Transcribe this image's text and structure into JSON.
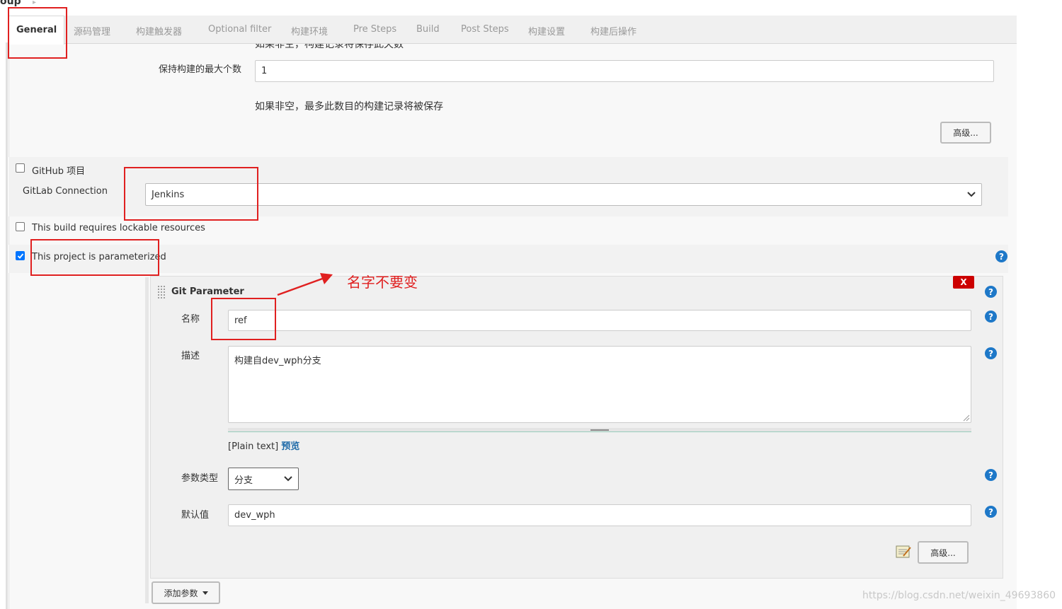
{
  "breadcrumb": {
    "fragment": "oup",
    "caret": "▸"
  },
  "tabs": [
    {
      "label": "General",
      "active": true
    },
    {
      "label": "源码管理"
    },
    {
      "label": "构建触发器"
    },
    {
      "label": "Optional filter"
    },
    {
      "label": "构建环境"
    },
    {
      "label": "Pre Steps"
    },
    {
      "label": "Build"
    },
    {
      "label": "Post Steps"
    },
    {
      "label": "构建设置"
    },
    {
      "label": "构建后操作"
    }
  ],
  "discard": {
    "cut_help": "如果非空，构建记录将保存此天数",
    "max_builds_label": "保持构建的最大个数",
    "max_builds_value": "1",
    "max_builds_help": "如果非空，最多此数目的构建记录将被保存",
    "advanced_label": "高级..."
  },
  "github": {
    "label": "GitHub 项目",
    "checked": false
  },
  "gitlab": {
    "label": "GitLab Connection",
    "value": "Jenkins"
  },
  "lockable": {
    "label": "This build requires lockable resources",
    "checked": false
  },
  "parameterized": {
    "label": "This project is parameterized",
    "checked": true
  },
  "git_parameter": {
    "title": "Git Parameter",
    "delete_label": "X",
    "name_label": "名称",
    "name_value": "ref",
    "desc_label": "描述",
    "desc_value": "构建自dev_wph分支",
    "format_text": "[Plain text]",
    "preview_label": "预览",
    "type_label": "参数类型",
    "type_value": "分支",
    "default_label": "默认值",
    "default_value": "dev_wph",
    "advanced_label": "高级..."
  },
  "add_param_label": "添加参数",
  "annotation": "名字不要变",
  "watermark": "https://blog.csdn.net/weixin_49693860",
  "help_glyph": "?",
  "colors": {
    "accent": "#1e78c8",
    "danger": "#cc0000",
    "annotation": "#e02020",
    "checkbox": "#0075ff"
  }
}
